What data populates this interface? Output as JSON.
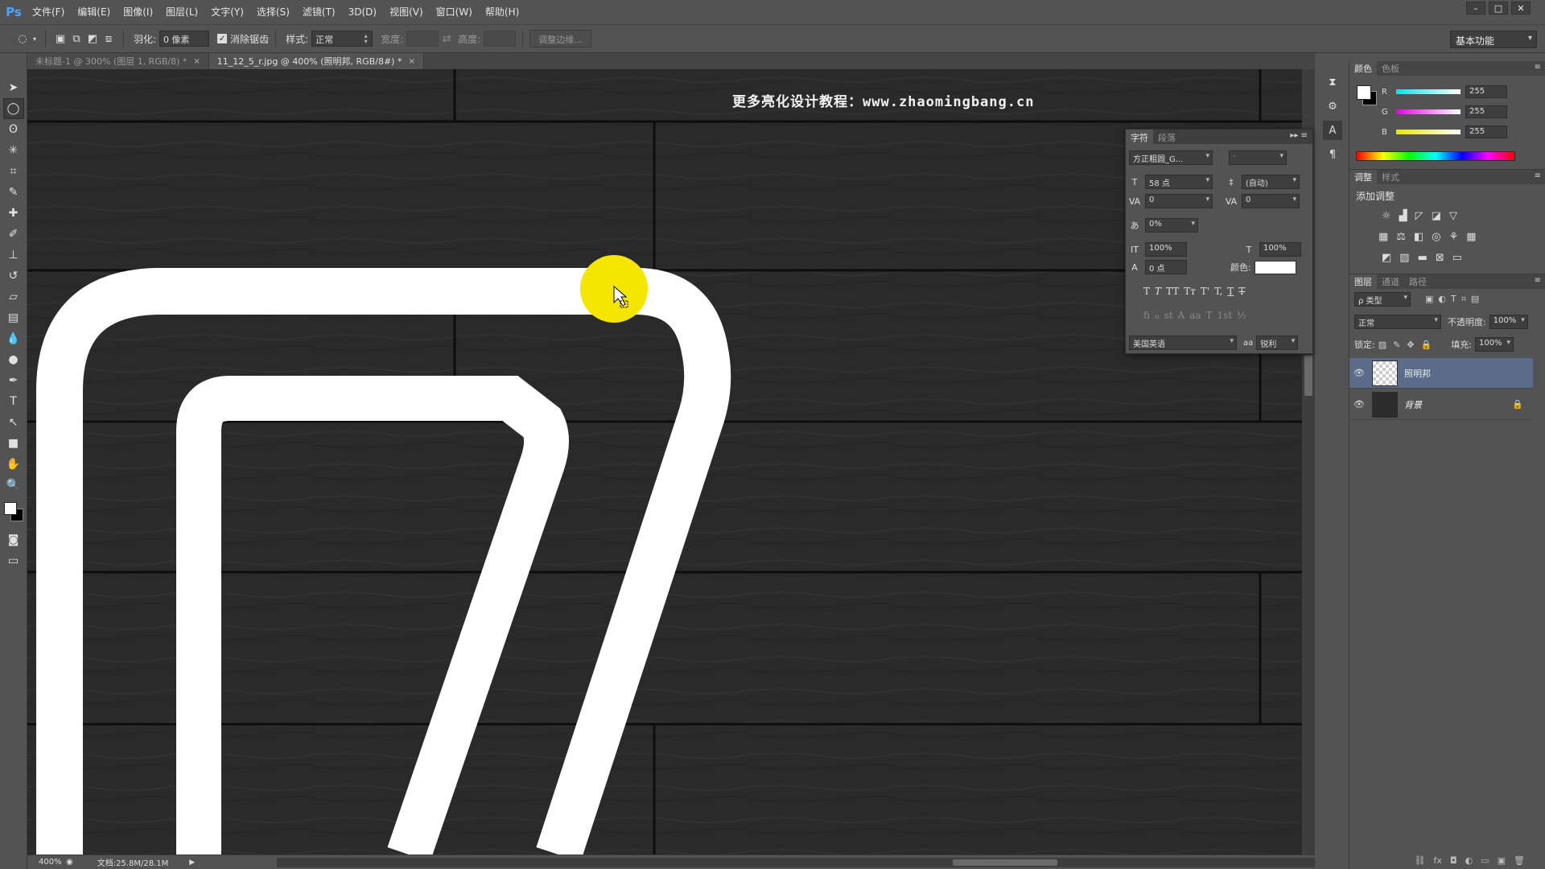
{
  "app": {
    "logo": "Ps"
  },
  "menu": [
    "文件(F)",
    "编辑(E)",
    "图像(I)",
    "图层(L)",
    "文字(Y)",
    "选择(S)",
    "滤镜(T)",
    "3D(D)",
    "视图(V)",
    "窗口(W)",
    "帮助(H)"
  ],
  "window_controls": [
    "–",
    "□",
    "✕"
  ],
  "options": {
    "feather_label": "羽化:",
    "feather_value": "0 像素",
    "antialias_label": "消除锯齿",
    "antialias_checked": true,
    "style_label": "样式:",
    "style_value": "正常",
    "width_label": "宽度:",
    "height_label": "高度:",
    "refine_button": "调整边缘...",
    "workspace": "基本功能"
  },
  "tabs": [
    {
      "label": "未标题-1 @ 300% (图层 1, RGB/8) *",
      "active": false,
      "close": "×"
    },
    {
      "label": "11_12_5_r.jpg @ 400% (照明邦, RGB/8#) *",
      "active": true,
      "close": "×"
    }
  ],
  "canvas": {
    "watermark": "更多亮化设计教程：www.zhaomingbang.cn",
    "background": "#282828",
    "stroke_color": "#ffffff",
    "highlight_color": "#f5e600"
  },
  "status": {
    "zoom": "400%",
    "doc_size": "文档:25.8M/28.1M"
  },
  "character_panel": {
    "tabs": [
      "字符",
      "段落"
    ],
    "font_family": "方正粗圆_G...",
    "font_style": "-",
    "font_size": "58 点",
    "leading": "(自动)",
    "kerning": "0",
    "tracking": "0",
    "tsume": "0%",
    "vertical_scale": "100%",
    "horizontal_scale": "100%",
    "baseline_shift": "0 点",
    "color_label": "颜色:",
    "color": "#ffffff",
    "style_buttons": [
      "T",
      "T",
      "TT",
      "Tт",
      "T'",
      "T,",
      "T",
      "T"
    ],
    "opentype_buttons": [
      "fi",
      "ℴ",
      "st",
      "A",
      "aa",
      "T",
      "1st",
      "½"
    ],
    "language": "美国英语",
    "aa_label": "aa",
    "antialias": "锐利"
  },
  "color_panel": {
    "tabs": [
      "颜色",
      "色板"
    ],
    "fg": "#ffffff",
    "bg": "#000000",
    "channels": [
      {
        "name": "R",
        "value": "255",
        "color": "#00e5e5"
      },
      {
        "name": "G",
        "value": "255",
        "color": "#e600e6"
      },
      {
        "name": "B",
        "value": "255",
        "color": "#e6e600"
      }
    ]
  },
  "adjust_panel": {
    "tabs": [
      "调整",
      "样式"
    ],
    "heading": "添加调整"
  },
  "layers_panel": {
    "tabs": [
      "图层",
      "通道",
      "路径"
    ],
    "filter_label": "ρ 类型",
    "blend_mode": "正常",
    "opacity_label": "不透明度:",
    "opacity": "100%",
    "lock_label": "锁定:",
    "fill_label": "填充:",
    "fill": "100%",
    "layers": [
      {
        "name": "照明邦",
        "selected": true,
        "locked": false,
        "thumb": "transparent"
      },
      {
        "name": "背景",
        "selected": false,
        "locked": true,
        "thumb": "dark"
      }
    ],
    "footer_icons": [
      "⛓",
      "fx",
      "◘",
      "◐",
      "▭",
      "▣",
      "🗑"
    ]
  }
}
